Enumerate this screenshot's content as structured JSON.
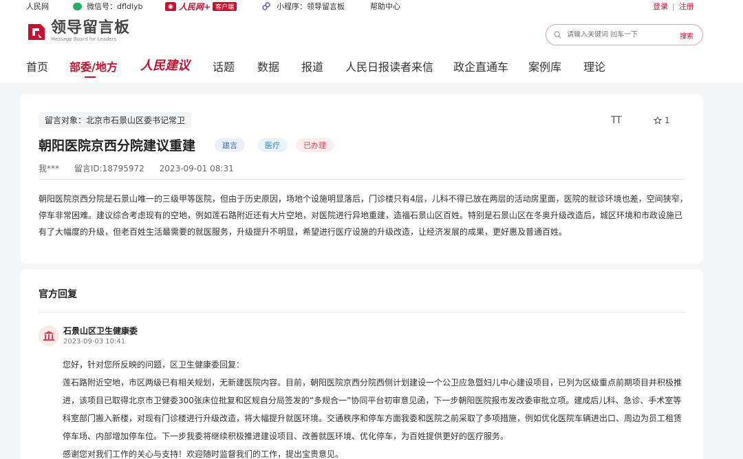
{
  "topbar": {
    "site": "人民网",
    "wechat": "微信号：dfldlyb",
    "weibo_brand": "人民网+",
    "weibo_badge": "客户端",
    "miniprogram": "小程序：领导留言板",
    "help": "帮助中心",
    "login": "登录",
    "separator": "|",
    "register": "注册"
  },
  "header": {
    "logo_cn": "领导留言板",
    "logo_en": "Message Board for Leaders",
    "search_placeholder": "请输入关键词 回车一下",
    "search_button": "搜索"
  },
  "nav": {
    "items": [
      {
        "label": "首页"
      },
      {
        "label": "部委/地方"
      },
      {
        "label": "人民建议"
      },
      {
        "label": "话题"
      },
      {
        "label": "数据"
      },
      {
        "label": "报道"
      },
      {
        "label": "人民日报读者来信"
      },
      {
        "label": "政企直通车"
      },
      {
        "label": "案例库"
      },
      {
        "label": "理论"
      }
    ],
    "active": "部委/地方"
  },
  "message": {
    "target": "留言对象：北京市石景山区委书记常卫",
    "title": "朝阳医院京西分院建议重建",
    "tags": [
      "建言",
      "医疗",
      "已办理"
    ],
    "font_icon": "TT",
    "favorites": "1",
    "author": "我***",
    "message_id": "留言ID:18795972",
    "datetime": "2023-09-01 08:31",
    "body": "朝阳医院京西分院是石景山唯一的三级甲等医院，但由于历史原因，场地个设施明显落后，门诊楼只有4层，儿科不得已放在两层的活动房里面，医院的就诊环境也差，空间狭窄，停车非常困难。建议综合考虑现有的空地，例如莲石路附近还有大片空地，对医院进行异地重建，造福石景山区百姓。特别是石景山区在冬奥升级改造后，城区环境和市政设施已有了大幅度的升级，但老百姓生活最需要的就医服务，升级提升不明显，希望进行医疗设施的升级改造，让经济发展的成果，更好惠及普通百姓。"
  },
  "reply": {
    "heading": "官方回复",
    "org": "石景山区卫生健康委",
    "date": "2023-09-03 10:41",
    "paragraphs": [
      "您好，针对您所反映的问题，区卫生健康委回复：",
      "莲石路附近空地，市区两级已有相关规划，无新建医院内容。目前，朝阳医院京西分院西侧计划建设一个公卫应急暨妇儿中心建设项目，已列为区级重点前期项目并积极推进，该项目已取得北京市卫健委300张床位批复和区规自分局签发的“多规合一”协同平台初审意见函，下一步朝阳医院报市发改委审批立项。建成后儿科、急诊、手术室等科室部门搬入新楼，对现有门诊楼进行升级改造，将大幅提升就医环境。交通秩序和停车方面我委和医院之前采取了多项措施，例如优化医院车辆进出口、周边为员工租赁停车场、内部增加停车位。下一步我委将继续积极推进建设项目、改善就医环境、优化停车，为百姓提供更好的医疗服务。",
      "感谢您对我们工作的关心与支持！欢迎随时监督我们的工作，提出宝贵意见。"
    ]
  },
  "colors": {
    "brand_red": "#c8102e",
    "wechat_green": "#2aae67"
  }
}
